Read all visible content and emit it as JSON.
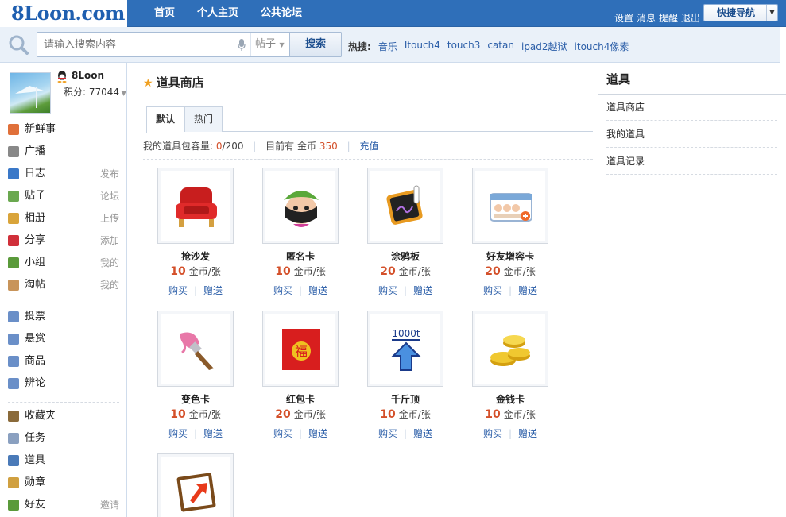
{
  "site": {
    "logo": "8Loon.com"
  },
  "nav": {
    "items": [
      "首页",
      "个人主页",
      "公共论坛"
    ]
  },
  "user_links": [
    "设置",
    "消息",
    "提醒",
    "退出"
  ],
  "quick_nav": {
    "label": "快捷导航"
  },
  "search": {
    "placeholder": "请输入搜索内容",
    "type": "帖子",
    "button": "搜索",
    "hot_label": "热搜:",
    "hot_terms": [
      "音乐",
      "Itouch4",
      "touch3",
      "catan",
      "ipad2越狱",
      "itouch4像素"
    ]
  },
  "profile": {
    "name": "8Loon",
    "score": "积分: 77044"
  },
  "sidebar": {
    "group1": [
      {
        "label": "新鲜事",
        "action": "",
        "icon": "feed-icon",
        "color": "#e0703a"
      },
      {
        "label": "广播",
        "action": "",
        "icon": "broadcast-icon",
        "color": "#888888"
      },
      {
        "label": "日志",
        "action": "发布",
        "icon": "blog-icon",
        "color": "#3a78c8"
      },
      {
        "label": "贴子",
        "action": "论坛",
        "icon": "post-icon",
        "color": "#6aa84f"
      },
      {
        "label": "相册",
        "action": "上传",
        "icon": "album-icon",
        "color": "#d9a43a"
      },
      {
        "label": "分享",
        "action": "添加",
        "icon": "share-icon",
        "color": "#d0303a"
      },
      {
        "label": "小组",
        "action": "我的",
        "icon": "group-icon",
        "color": "#5a9a3a"
      },
      {
        "label": "淘帖",
        "action": "我的",
        "icon": "taotie-icon",
        "color": "#c8945a"
      }
    ],
    "group2": [
      {
        "label": "投票",
        "action": "",
        "icon": "poll-icon",
        "color": "#6a8fc8"
      },
      {
        "label": "悬赏",
        "action": "",
        "icon": "reward-icon",
        "color": "#6a8fc8"
      },
      {
        "label": "商品",
        "action": "",
        "icon": "goods-icon",
        "color": "#6a8fc8"
      },
      {
        "label": "辨论",
        "action": "",
        "icon": "debate-icon",
        "color": "#6a8fc8"
      }
    ],
    "group3": [
      {
        "label": "收藏夹",
        "action": "",
        "icon": "favorites-icon",
        "color": "#8a6a3a"
      },
      {
        "label": "任务",
        "action": "",
        "icon": "task-icon",
        "color": "#8aa0c0"
      },
      {
        "label": "道具",
        "action": "",
        "icon": "tool-icon",
        "color": "#4a7ab8"
      },
      {
        "label": "勋章",
        "action": "",
        "icon": "medal-icon",
        "color": "#d0a040"
      },
      {
        "label": "好友",
        "action": "邀请",
        "icon": "friend-icon",
        "color": "#5a9a3a"
      }
    ]
  },
  "main": {
    "title": "道具商店",
    "tabs": [
      "默认",
      "热门"
    ],
    "info": {
      "capacity_label": "我的道具包容量:",
      "capacity_used": "0",
      "capacity_total": "/200",
      "coins_label": "目前有 金币",
      "coins": "350",
      "recharge": "充值"
    },
    "items": [
      {
        "name": "抢沙发",
        "price": "10",
        "unit": "金币/张",
        "icon": "sofa-icon",
        "buy": "购买",
        "gift": "赠送"
      },
      {
        "name": "匿名卡",
        "price": "10",
        "unit": "金币/张",
        "icon": "anonymous-icon",
        "buy": "购买",
        "gift": "赠送"
      },
      {
        "name": "涂鸦板",
        "price": "20",
        "unit": "金币/张",
        "icon": "graffiti-board-icon",
        "buy": "购买",
        "gift": "赠送"
      },
      {
        "name": "好友增容卡",
        "price": "20",
        "unit": "金币/张",
        "icon": "friend-capacity-icon",
        "buy": "购买",
        "gift": "赠送"
      },
      {
        "name": "变色卡",
        "price": "10",
        "unit": "金币/张",
        "icon": "paint-brush-icon",
        "buy": "购买",
        "gift": "赠送"
      },
      {
        "name": "红包卡",
        "price": "20",
        "unit": "金币/张",
        "icon": "red-envelope-icon",
        "buy": "购买",
        "gift": "赠送",
        "glyph": "福"
      },
      {
        "name": "千斤顶",
        "price": "10",
        "unit": "金币/张",
        "icon": "jack-icon",
        "buy": "购买",
        "gift": "赠送",
        "glyph": "1000t"
      },
      {
        "name": "金钱卡",
        "price": "10",
        "unit": "金币/张",
        "icon": "gold-coins-icon",
        "buy": "购买",
        "gift": "赠送"
      },
      {
        "name": "",
        "price": "",
        "unit": "",
        "icon": "up-arrow-card-icon",
        "buy": "",
        "gift": ""
      }
    ]
  },
  "right": {
    "title": "道具",
    "links": [
      "道具商店",
      "我的道具",
      "道具记录"
    ]
  }
}
